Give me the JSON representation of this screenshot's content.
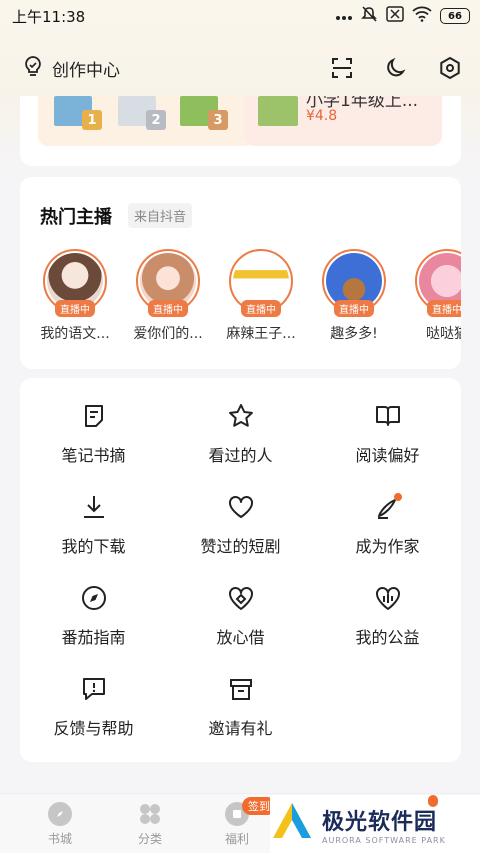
{
  "status_bar": {
    "time": "上午11:38",
    "battery": "66"
  },
  "header": {
    "creator_center": "创作中心"
  },
  "promo": {
    "ranks": [
      "1",
      "2",
      "3"
    ],
    "title": "小学1年级上...",
    "price": "¥4.8"
  },
  "hot_streamers": {
    "title": "热门主播",
    "tag": "来自抖音",
    "live_label": "直播中",
    "items": [
      {
        "name": "我的语文..."
      },
      {
        "name": "爱你们的..."
      },
      {
        "name": "麻辣王子..."
      },
      {
        "name": "趣多多!"
      },
      {
        "name": "哒哒猫"
      }
    ]
  },
  "menu": {
    "items": [
      {
        "label": "笔记书摘",
        "icon": "note-icon"
      },
      {
        "label": "看过的人",
        "icon": "star-icon"
      },
      {
        "label": "阅读偏好",
        "icon": "book-icon"
      },
      {
        "label": "我的下载",
        "icon": "download-icon"
      },
      {
        "label": "赞过的短剧",
        "icon": "heart-icon"
      },
      {
        "label": "成为作家",
        "icon": "pen-icon"
      },
      {
        "label": "番茄指南",
        "icon": "compass-icon"
      },
      {
        "label": "放心借",
        "icon": "loan-icon"
      },
      {
        "label": "我的公益",
        "icon": "charity-icon"
      },
      {
        "label": "反馈与帮助",
        "icon": "feedback-icon"
      },
      {
        "label": "邀请有礼",
        "icon": "gift-icon"
      }
    ]
  },
  "tabbar": {
    "items": [
      {
        "label": "书城"
      },
      {
        "label": "分类"
      },
      {
        "label": "福利",
        "badge": "签到"
      }
    ]
  },
  "watermark": {
    "main": "极光软件园",
    "sub": "AURORA SOFTWARE PARK"
  },
  "colors": {
    "accent": "#ee7a45",
    "badge": "#f16b2f"
  }
}
